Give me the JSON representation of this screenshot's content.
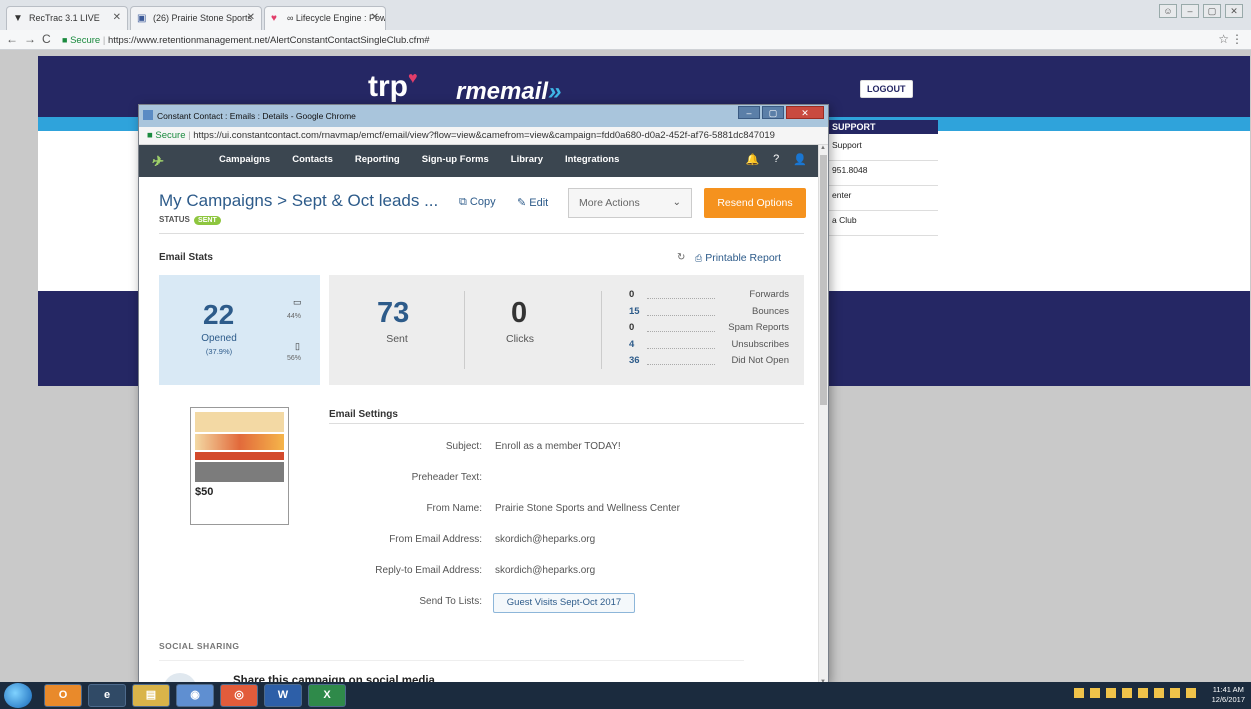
{
  "browser": {
    "tabs": [
      {
        "label": "RecTrac 3.1 LIVE",
        "icon": "v"
      },
      {
        "label": "(26) Prairie Stone Sports",
        "icon": "f"
      },
      {
        "label": "∞ Lifecycle Engine : Pow",
        "icon": "♥"
      }
    ],
    "secure_label": "Secure",
    "url": "https://www.retentionmanagement.net/AlertConstantContactSingleClub.cfm#"
  },
  "bgpage": {
    "logo_trp": "trp",
    "logo_rmemail": "rmemail",
    "logout_label": "LOGOUT",
    "support_title": "SUPPORT",
    "support_items": [
      "Support",
      "951.8048",
      "enter",
      "a Club"
    ]
  },
  "popup": {
    "window_title": "Constant Contact : Emails : Details - Google Chrome",
    "secure_label": "Secure",
    "url": "https://ui.constantcontact.com/rnavmap/emcf/email/view?flow=view&camefrom=view&campaign=fdd0a680-d0a2-452f-af76-5881dc847019",
    "nav": [
      "Campaigns",
      "Contacts",
      "Reporting",
      "Sign-up Forms",
      "Library",
      "Integrations"
    ],
    "breadcrumb_root": "My Campaigns",
    "breadcrumb_sep": ">",
    "campaign_name": "Sept & Oct leads ...",
    "copy_label": "Copy",
    "edit_label": "Edit",
    "more_actions_label": "More Actions",
    "resend_label": "Resend Options",
    "status_label": "STATUS",
    "status_value": "SENT"
  },
  "stats": {
    "title": "Email Stats",
    "printable_label": "Printable Report",
    "opened": "22",
    "opened_label": "Opened",
    "opened_pct": "(37.9%)",
    "desktop_pct": "44%",
    "mobile_pct": "56%",
    "sent": "73",
    "sent_label": "Sent",
    "clicks": "0",
    "clicks_label": "Clicks",
    "metrics": [
      {
        "value": "0",
        "label": "Forwards",
        "color": "#333333"
      },
      {
        "value": "15",
        "label": "Bounces",
        "color": "#2d5b8a"
      },
      {
        "value": "0",
        "label": "Spam Reports",
        "color": "#333333"
      },
      {
        "value": "4",
        "label": "Unsubscribes",
        "color": "#2d5b8a"
      },
      {
        "value": "36",
        "label": "Did Not Open",
        "color": "#2d5b8a"
      }
    ]
  },
  "settings": {
    "title": "Email Settings",
    "rows": [
      {
        "label": "Subject:",
        "value": "Enroll as a member TODAY!"
      },
      {
        "label": "Preheader Text:",
        "value": ""
      },
      {
        "label": "From Name:",
        "value": "Prairie Stone Sports and Wellness Center"
      },
      {
        "label": "From Email Address:",
        "value": "skordich@heparks.org"
      },
      {
        "label": "Reply-to Email Address:",
        "value": "skordich@heparks.org"
      },
      {
        "label": "Send To Lists:",
        "value": ""
      }
    ],
    "list_chip": "Guest Visits Sept-Oct 2017"
  },
  "thumbnail": {
    "price": "$50"
  },
  "social": {
    "title": "SOCIAL SHARING",
    "share_text": "Share this campaign on social media"
  },
  "taskbar": {
    "time": "11:41 AM",
    "date": "12/6/2017"
  }
}
